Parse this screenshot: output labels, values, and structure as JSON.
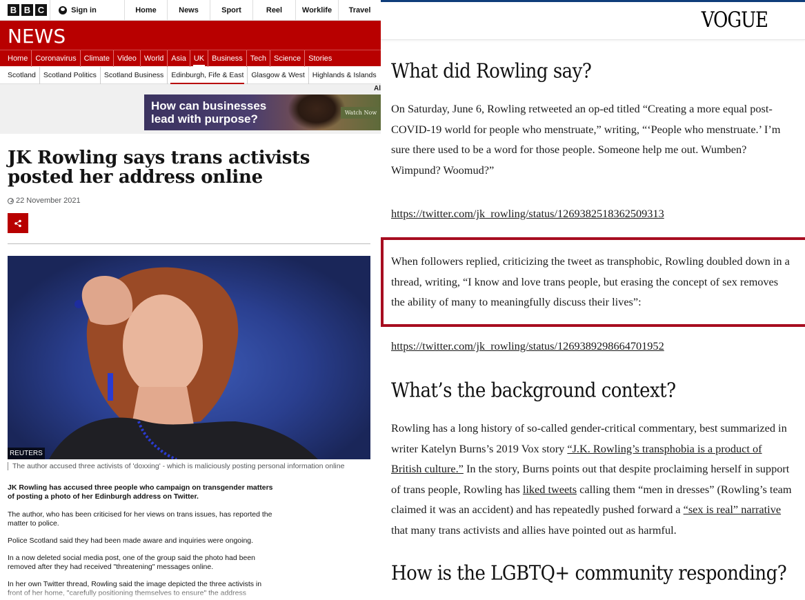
{
  "bbc": {
    "logo_letters": [
      "B",
      "B",
      "C"
    ],
    "signin": "Sign in",
    "top_nav": [
      "Home",
      "News",
      "Sport",
      "Reel",
      "Worklife",
      "Travel"
    ],
    "brand": "NEWS",
    "sections": [
      "Home",
      "Coronavirus",
      "Climate",
      "Video",
      "World",
      "Asia",
      "UK",
      "Business",
      "Tech",
      "Science",
      "Stories"
    ],
    "active_section": "UK",
    "subsections": [
      "Scotland",
      "Scotland Politics",
      "Scotland Business",
      "Edinburgh, Fife & East",
      "Glasgow & West",
      "Highlands & Islands"
    ],
    "active_subsection": "Edinburgh, Fife & East",
    "ad_label": "Al",
    "ad_text": "How can businesses lead with purpose?",
    "ad_cta": "Watch Now",
    "headline": "JK Rowling says trans activists posted her address online",
    "date": "22 November 2021",
    "photo_credit": "REUTERS",
    "caption": "The author accused three activists of 'doxxing' - which is maliciously posting personal information online",
    "paragraphs": [
      "JK Rowling has accused three people who campaign on transgender matters of posting a photo of her Edinburgh address on Twitter.",
      "The author, who has been criticised for her views on trans issues, has reported the matter to police.",
      "Police Scotland said they had been made aware and inquiries were ongoing.",
      "In a now deleted social media post, one of the group said the photo had been removed after they had received \"threatening\" messages online.",
      "In her own Twitter thread, Rowling said the image depicted the three activists in front of her home, \"carefully positioning themselves to ensure\" the address"
    ],
    "colors": {
      "brand_red": "#b80000"
    }
  },
  "vogue": {
    "logo": "VOGUE",
    "h_what_said": "What did Rowling say?",
    "p1": "On Saturday, June 6, Rowling retweeted an op-ed titled “Creating a more equal post-COVID-19 world for people who menstruate,” writing, “‘People who menstruate.’ I’m sure there used to be a word for those people. Someone help me out. Wumben? Wimpund? Woomud?”",
    "link1": "https://twitter.com/jk_rowling/status/1269382518362509313",
    "p2": "When followers replied, criticizing the tweet as transphobic, Rowling doubled down in a thread, writing, “I know and love trans people, but erasing the concept of sex removes the ability of many to meaningfully discuss their lives”:",
    "link2": "https://twitter.com/jk_rowling/status/1269389298664701952",
    "h_background": "What’s the background context?",
    "p3_a": "Rowling has a long history of so-called gender-critical commentary, best summarized in writer Katelyn Burns’s 2019 Vox story ",
    "p3_link1": "“J.K. Rowling’s transphobia is a product of British culture.”",
    "p3_b": " In the story, Burns points out that despite proclaiming herself in support of trans people, Rowling has ",
    "p3_link2": "liked tweets",
    "p3_c": " calling them “men in dresses” (Rowling’s team claimed it was an accident) and has repeatedly pushed forward a ",
    "p3_link3": "“sex is real” narrative",
    "p3_d": " that many trans activists and allies have pointed out as harmful.",
    "h_community": "How is the LGBTQ+ community responding?",
    "colors": {
      "highlight_border": "#a70d20"
    }
  }
}
